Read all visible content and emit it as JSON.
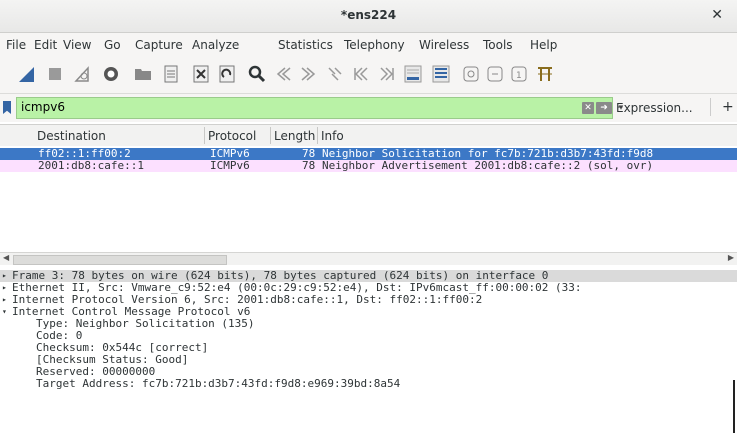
{
  "window": {
    "title": "*ens224"
  },
  "menu": [
    "File",
    "Edit",
    "View",
    "Go",
    "Capture",
    "Analyze",
    "Statistics",
    "Telephony",
    "Wireless",
    "Tools",
    "Help"
  ],
  "filter": {
    "value": "icmpv6",
    "expression_label": "Expression...",
    "add_label": "+"
  },
  "columns": [
    "Destination",
    "Protocol",
    "Length",
    "Info"
  ],
  "packets": [
    {
      "destination": "ff02::1:ff00:2",
      "protocol": "ICMPv6",
      "length": "78",
      "info": "Neighbor Solicitation for fc7b:721b:d3b7:43fd:f9d8",
      "selected": true
    },
    {
      "destination": "2001:db8:cafe::1",
      "protocol": "ICMPv6",
      "length": "78",
      "info": "Neighbor Advertisement 2001:db8:cafe::2 (sol, ovr)",
      "selected": false
    }
  ],
  "details": [
    {
      "expander": "▸",
      "text": "Frame 3: 78 bytes on wire (624 bits), 78 bytes captured (624 bits) on interface 0"
    },
    {
      "expander": "▸",
      "text": "Ethernet II, Src: Vmware_c9:52:e4 (00:0c:29:c9:52:e4), Dst: IPv6mcast_ff:00:00:02 (33:"
    },
    {
      "expander": "▸",
      "text": "Internet Protocol Version 6, Src: 2001:db8:cafe::1, Dst: ff02::1:ff00:2"
    },
    {
      "expander": "▾",
      "text": "Internet Control Message Protocol v6"
    },
    {
      "expander": "",
      "text": "Type: Neighbor Solicitation (135)"
    },
    {
      "expander": "",
      "text": "Code: 0"
    },
    {
      "expander": "",
      "text": "Checksum: 0x544c [correct]"
    },
    {
      "expander": "",
      "text": "[Checksum Status: Good]"
    },
    {
      "expander": "",
      "text": "Reserved: 00000000"
    },
    {
      "expander": "",
      "text": "Target Address: fc7b:721b:d3b7:43fd:f9d8:e969:39bd:8a54"
    }
  ],
  "colors": {
    "selected_row": "#3c78c6",
    "icmp_row": "#fce0ff",
    "filter_ok": "#b9f2a6",
    "shark_blue": "#3465a4"
  }
}
